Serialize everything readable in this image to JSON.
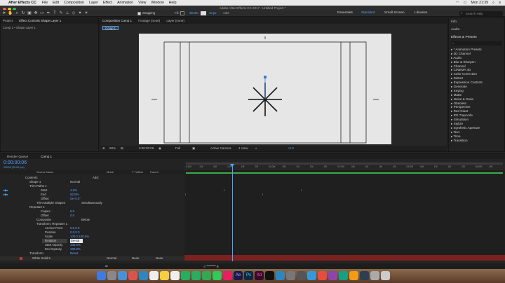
{
  "menubar": {
    "app_name": "After Effects CC",
    "items": [
      "File",
      "Edit",
      "Composition",
      "Layer",
      "Effect",
      "Animation",
      "View",
      "Window",
      "Help"
    ],
    "clock": "Mon 21:39"
  },
  "window": {
    "title": "Adobe After Effects CC 2017 - Untitled Project *"
  },
  "toolbar": {
    "snapping_label": "Snapping",
    "fill_label": "Fill:",
    "stroke_label": "Stroke:",
    "stroke_width": "10 px",
    "add_label": "Add:",
    "workspaces": [
      "Essentials",
      "Standard",
      "Small Screen",
      "Libraries"
    ],
    "active_workspace": "Standard",
    "search_placeholder": "Search Help"
  },
  "project_panel": {
    "tab": "Project",
    "layer_label": "Comp 1 • Shape Layer 1"
  },
  "effect_controls": {
    "tab": "Effect Controls Shape Layer 1"
  },
  "composition_panel": {
    "tabs": [
      "Composition Comp 1",
      "Footage (none)",
      "Layer (none)"
    ],
    "comp_tab": "Comp 1",
    "zoom": "50%",
    "timecode": "0:00:00:06",
    "resolution": "Full",
    "camera": "Active Camera",
    "views": "1 View",
    "exposure": "+0.0"
  },
  "right_panel": {
    "info_label": "Info",
    "audio_label": "Audio",
    "effects_title": "Effects & Presets",
    "items": [
      "* Animation Presets",
      "3D Channel",
      "Audio",
      "Blur & Sharpen",
      "Channel",
      "CINEMA 4D",
      "Color Correction",
      "Distort",
      "Expression Controls",
      "Generate",
      "Keying",
      "Matte",
      "Noise & Grain",
      "Obsolete",
      "Perspective",
      "Red Giant",
      "RG Trapcode",
      "Simulation",
      "Stylize",
      "Synthetic Aperture",
      "Text",
      "Time",
      "Transition"
    ]
  },
  "timeline": {
    "tabs": [
      "Render Queue",
      "Comp 1"
    ],
    "timecode": "0:00:00:06",
    "frame_info": "00006 (25.00 fps)",
    "columns": [
      "Source Name",
      "Mode",
      "T TrkMat",
      "Parent"
    ],
    "rows": [
      {
        "name": "Contents",
        "value": "Add:"
      },
      {
        "name": "Shape 1",
        "value": "Normal"
      },
      {
        "name": "Trim Paths 1",
        "value": ""
      },
      {
        "name": "Start",
        "value": "4.6%"
      },
      {
        "name": "End",
        "value": "92.5%"
      },
      {
        "name": "Offset",
        "value": "0x+0.0°"
      },
      {
        "name": "Trim Multiple Shapes",
        "value": "Simultaneously"
      },
      {
        "name": "Repeater 1",
        "value": ""
      },
      {
        "name": "Copies",
        "value": "8.0"
      },
      {
        "name": "Offset",
        "value": "0.0"
      },
      {
        "name": "Composite",
        "value": "Below"
      },
      {
        "name": "Transform: Repeater 1",
        "value": ""
      },
      {
        "name": "Anchor Point",
        "value": "0.0,0.0"
      },
      {
        "name": "Position",
        "value": "0.0,0.0"
      },
      {
        "name": "Scale",
        "value": "100.0,100.0%"
      },
      {
        "name": "Rotation",
        "value": "0x+45"
      },
      {
        "name": "Start Opacity",
        "value": "100.0%"
      },
      {
        "name": "End Opacity",
        "value": "100.0%"
      },
      {
        "name": "Transform",
        "value": "Reset"
      }
    ],
    "layer2": {
      "name": "White Solid 5",
      "mode": "Normal",
      "trkmat": "None",
      "parent": "None"
    },
    "ruler": [
      "0:00f",
      "00f",
      "05f",
      "10f",
      "15f",
      "20f",
      "01:00f",
      "05f",
      "10f",
      "15f",
      "20f",
      "02:00f",
      "05f",
      "10f",
      "15f",
      "20f",
      "03:00f",
      "05f",
      "10f",
      "15f",
      "20f",
      "04:00f",
      "05f"
    ]
  },
  "colors": {
    "accent": "#4da3ff",
    "time_marker": "#3a7bd5",
    "label_red": "#c0392b"
  }
}
